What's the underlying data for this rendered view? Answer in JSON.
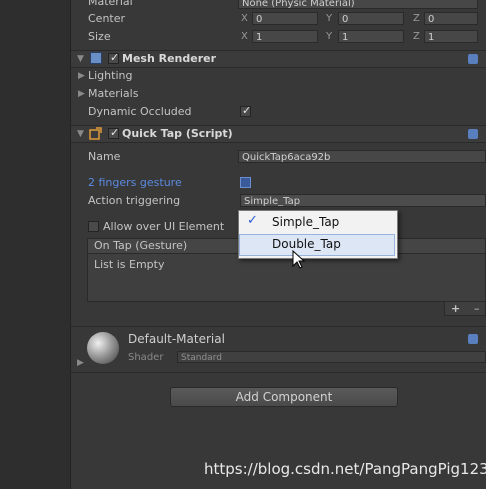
{
  "transform": {
    "material_label": "Material",
    "material_value": "None (Physic Material)",
    "center_label": "Center",
    "size_label": "Size",
    "axis_x": "X",
    "axis_y": "Y",
    "axis_z": "Z",
    "center": {
      "x": "0",
      "y": "0",
      "z": "0"
    },
    "size": {
      "x": "1",
      "y": "1",
      "z": "1"
    }
  },
  "mesh_renderer": {
    "title": "Mesh Renderer",
    "lighting": "Lighting",
    "materials": "Materials",
    "dynamic_occluded": "Dynamic Occluded"
  },
  "quick_tap": {
    "title": "Quick Tap (Script)",
    "name_label": "Name",
    "name_value": "QuickTap6aca92b",
    "fingers_label": "2 fingers gesture",
    "action_label": "Action triggering",
    "action_value": "Simple_Tap",
    "allow_ui_label": "Allow over UI Element",
    "event_header": "On Tap (Gesture)",
    "list_empty": "List is Empty",
    "plus": "+",
    "minus": "–"
  },
  "dropdown": {
    "check": "✓",
    "options": [
      "Simple_Tap",
      "Double_Tap"
    ]
  },
  "material": {
    "name": "Default-Material",
    "shader_label": "Shader",
    "shader_value": "Standard"
  },
  "add_component": "Add Component",
  "watermark": "https://blog.csdn.net/PangPangPig123"
}
